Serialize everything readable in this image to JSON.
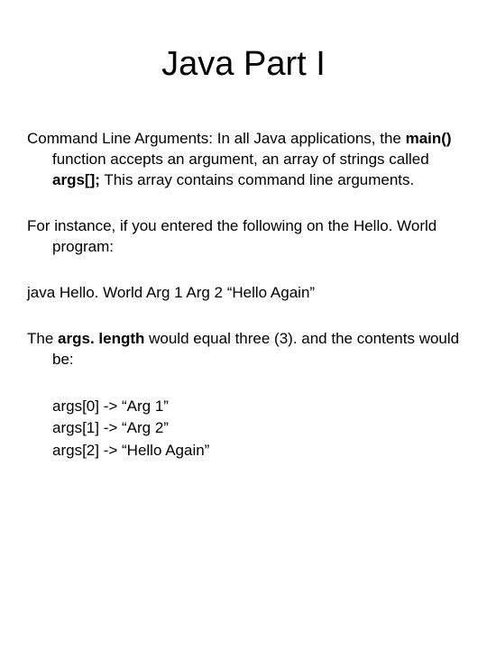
{
  "title": "Java Part I",
  "p1": {
    "lead": "Command Line Arguments:",
    "t1": "  In all Java applications, the ",
    "main_fn": "main()",
    "t2": " function accepts an argument, an array of strings called ",
    "args_decl": "args[];",
    "t3": "  This array contains command line arguments."
  },
  "p2": "For instance, if you entered the following on the Hello. World program:",
  "p3": "java Hello. World Arg 1 Arg 2 “Hello Again”",
  "p4": {
    "t1": "The ",
    "args_len": "args. length",
    "t2": " would equal three (3). and the contents would be:"
  },
  "argsList": {
    "line0": "args[0] ->  “Arg 1”",
    "line1": "args[1] -> “Arg 2”",
    "line2": "args[2] -> “Hello Again”"
  }
}
